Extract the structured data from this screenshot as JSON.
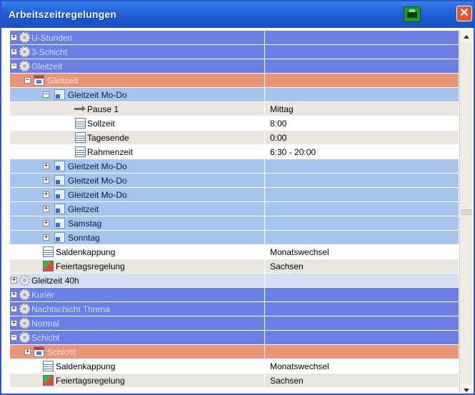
{
  "window": {
    "title": "Arbeitszeitregelungen",
    "close_glyph": "✕",
    "print_icon": "printer-icon"
  },
  "colors": {
    "title_blue": "#1f5fd6",
    "row_blue": "#6a7ee6",
    "row_orange": "#e9957a",
    "row_lightblue": "#a7c4ec",
    "print_green": "#1f9a2e",
    "close_red": "#e0552a"
  },
  "tree_rows": [
    {
      "label": "U-Stunden",
      "value": "",
      "expander": "+",
      "icon": "gear-icon"
    },
    {
      "label": "3-Schicht",
      "value": "",
      "expander": "+",
      "icon": "gear-icon"
    },
    {
      "label": "Gleitzeit",
      "value": "",
      "expander": "−",
      "icon": "gear-icon"
    },
    {
      "label": "Gleitzeit",
      "value": "",
      "expander": "−",
      "icon": "calendar-icon"
    },
    {
      "label": "Gleitzeit Mo-Do",
      "value": "",
      "expander": "−",
      "icon": "schedule-icon"
    },
    {
      "label": "Pause 1",
      "value": "Mittag",
      "expander": "",
      "icon": "pause-arrow-icon"
    },
    {
      "label": "Sollzeit",
      "value": "8:00",
      "expander": "",
      "icon": "document-icon"
    },
    {
      "label": "Tagesende",
      "value": "0:00",
      "expander": "",
      "icon": "document-icon"
    },
    {
      "label": "Rahmenzeit",
      "value": "6:30 - 20:00",
      "expander": "",
      "icon": "document-icon"
    },
    {
      "label": "Gleitzeit Mo-Do",
      "value": "",
      "expander": "+",
      "icon": "schedule-icon"
    },
    {
      "label": "Gleitzeit Mo-Do",
      "value": "",
      "expander": "+",
      "icon": "schedule-icon"
    },
    {
      "label": "Gleitzeit Mo-Do",
      "value": "",
      "expander": "+",
      "icon": "schedule-icon"
    },
    {
      "label": "Gleitzeit",
      "value": "",
      "expander": "+",
      "icon": "schedule-icon"
    },
    {
      "label": "Samstag",
      "value": "",
      "expander": "+",
      "icon": "schedule-icon"
    },
    {
      "label": "Sonntag",
      "value": "",
      "expander": "+",
      "icon": "schedule-icon"
    },
    {
      "label": "Saldenkappung",
      "value": "Monatswechsel",
      "expander": "",
      "icon": "document-icon"
    },
    {
      "label": "Feiertagsregelung",
      "value": "Sachsen",
      "expander": "",
      "icon": "holiday-icon"
    },
    {
      "label": "Gleitzeit 40h",
      "value": "",
      "expander": "+",
      "icon": "gear-icon"
    },
    {
      "label": "Kurier",
      "value": "",
      "expander": "+",
      "icon": "gear-icon"
    },
    {
      "label": "Nachtschicht Threna",
      "value": "",
      "expander": "+",
      "icon": "gear-icon"
    },
    {
      "label": "Normal",
      "value": "",
      "expander": "+",
      "icon": "gear-icon"
    },
    {
      "label": "Schicht",
      "value": "",
      "expander": "−",
      "icon": "gear-icon"
    },
    {
      "label": "Schicht",
      "value": "",
      "expander": "+",
      "icon": "calendar-icon"
    },
    {
      "label": "Saldenkappung",
      "value": "Monatswechsel",
      "expander": "",
      "icon": "document-icon"
    },
    {
      "label": "Feiertagsregelung",
      "value": "Sachsen",
      "expander": "",
      "icon": "holiday-icon"
    }
  ]
}
